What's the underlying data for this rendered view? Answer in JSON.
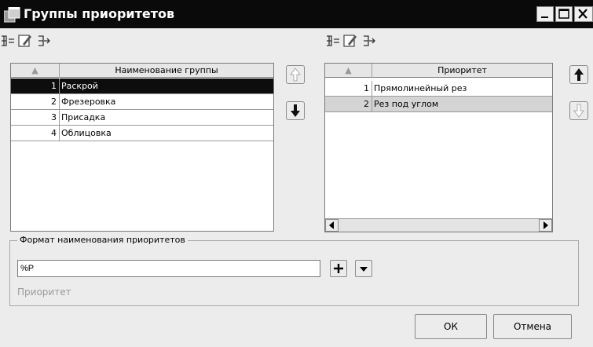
{
  "window": {
    "title": "Группы приоритетов"
  },
  "left_grid": {
    "columns": [
      "",
      "Наименование группы"
    ],
    "rows": [
      {
        "num": "1",
        "name": "Раскрой",
        "selected": true
      },
      {
        "num": "2",
        "name": "Фрезеровка",
        "selected": false
      },
      {
        "num": "3",
        "name": "Присадка",
        "selected": false
      },
      {
        "num": "4",
        "name": "Облицовка",
        "selected": false
      }
    ]
  },
  "right_grid": {
    "columns": [
      "",
      "Приоритет"
    ],
    "rows": [
      {
        "num": "1",
        "name": "Прямолинейный рез"
      },
      {
        "num": "2",
        "name": "Рез под углом"
      }
    ]
  },
  "format": {
    "legend": "Формат наименования приоритетов",
    "value": "%P",
    "hint": "Приоритет"
  },
  "buttons": {
    "ok": "ОК",
    "cancel": "Отмена"
  },
  "icons": [
    "window-app-icon",
    "insert-row-icon",
    "edit-icon",
    "append-row-icon",
    "arrow-up-icon",
    "arrow-down-icon",
    "plus-icon",
    "dropdown-arrow-icon"
  ]
}
